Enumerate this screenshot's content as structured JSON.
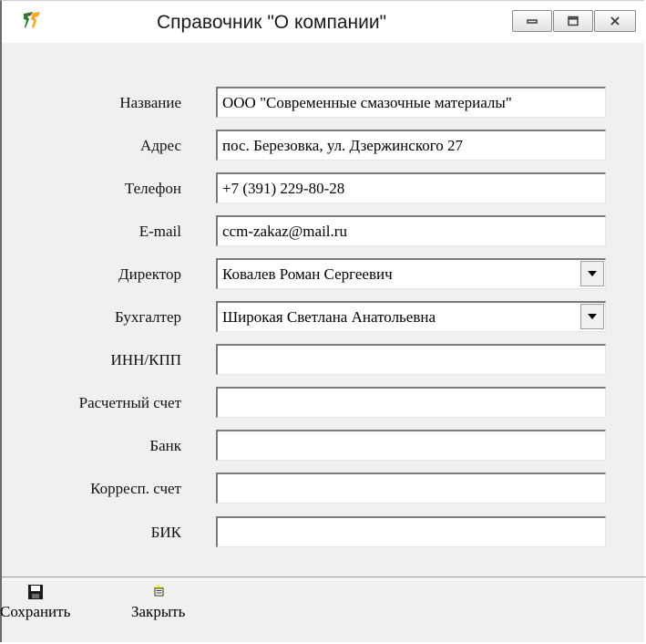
{
  "window": {
    "title": "Справочник \"О компании\"",
    "icon": "delphi-app-icon",
    "buttons": [
      "minimize-icon",
      "maximize-icon",
      "close-icon"
    ]
  },
  "form": {
    "name": {
      "label": "Название",
      "value": "ООО \"Современные смазочные материалы\""
    },
    "address": {
      "label": "Адрес",
      "value": "пос. Березовка, ул. Дзержинского 27"
    },
    "phone": {
      "label": "Телефон",
      "value": "+7 (391) 229-80-28"
    },
    "email": {
      "label": "E-mail",
      "value": "ccm-zakaz@mail.ru"
    },
    "director": {
      "label": "Директор",
      "value": "Ковалев Роман Сергеевич"
    },
    "accountant": {
      "label": "Бухгалтер",
      "value": "Широкая Светлана Анатольевна"
    },
    "inn_kpp": {
      "label": "ИНН/КПП",
      "value": ""
    },
    "account": {
      "label": "Расчетный счет",
      "value": ""
    },
    "bank": {
      "label": "Банк",
      "value": ""
    },
    "corr": {
      "label": "Корресп. счет",
      "value": ""
    },
    "bik": {
      "label": "БИК",
      "value": ""
    }
  },
  "toolbar": {
    "save_label": "Сохранить",
    "close_label": "Закрыть"
  },
  "colors": {
    "background": "#f0f0f0",
    "field_bg": "#ffffff",
    "field_border": "#7a7a7a"
  }
}
